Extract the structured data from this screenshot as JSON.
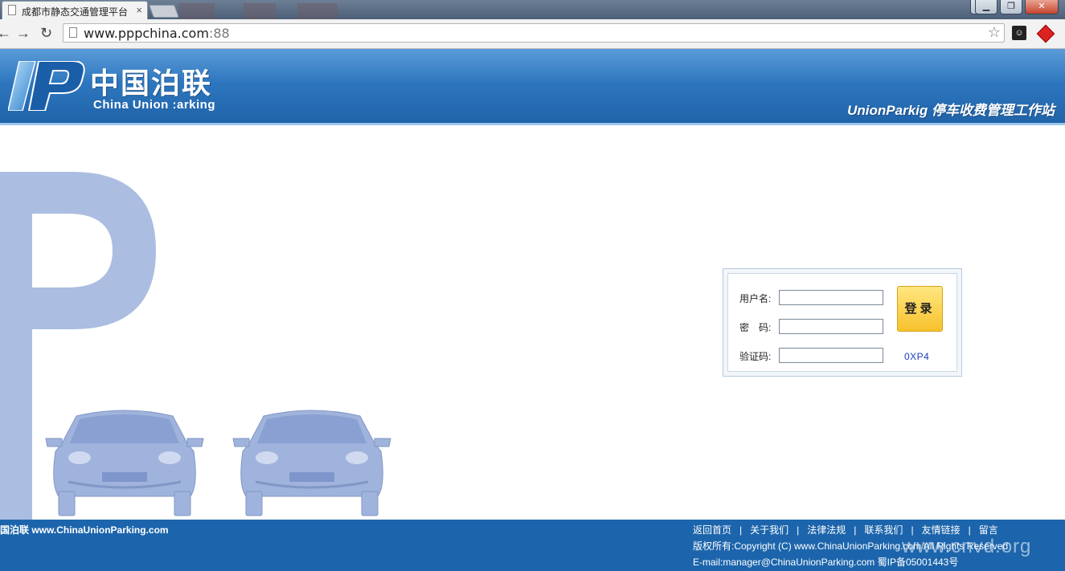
{
  "browser": {
    "tab_title": "成都市静态交通管理平台",
    "tab_close": "×",
    "url_host": "www.pppchina.com",
    "url_port": ":88",
    "window_buttons": [
      "▁",
      "❐",
      "✕"
    ]
  },
  "header": {
    "logo_cn": "中国泊联",
    "logo_en": "China Union :arking",
    "slogan": "UnionParkig 停车收费管理工作站"
  },
  "login": {
    "username_label": "用户名:",
    "password_label": "密　码:",
    "captcha_label": "验证码:",
    "username_value": "",
    "password_value": "",
    "captcha_value": "",
    "button_label": "登录",
    "captcha_code": "0XP4"
  },
  "footer": {
    "left_text": "国泊联 www.ChinaUnionParking.com",
    "links": [
      "返回首页",
      "关于我们",
      "法律法规",
      "联系我们",
      "友情链接",
      "留言"
    ],
    "copyright": "版权所有:Copyright (C) www.ChinaUnionParking.com All Rights Reserved",
    "email": "E-mail:manager@ChinaUnionParking.com 蜀IP备05001443号",
    "watermark": "www.cnvd.org"
  },
  "colors": {
    "header_blue": "#2d76be",
    "footer_blue": "#1c65ac",
    "decor_blue": "#a9bde0",
    "login_button": "#f7c12c",
    "captcha_text": "#1d3fbd"
  },
  "icons": [
    "back-arrow-icon",
    "forward-arrow-icon",
    "reload-icon",
    "page-icon",
    "star-icon",
    "extension-icon",
    "user-icon"
  ]
}
